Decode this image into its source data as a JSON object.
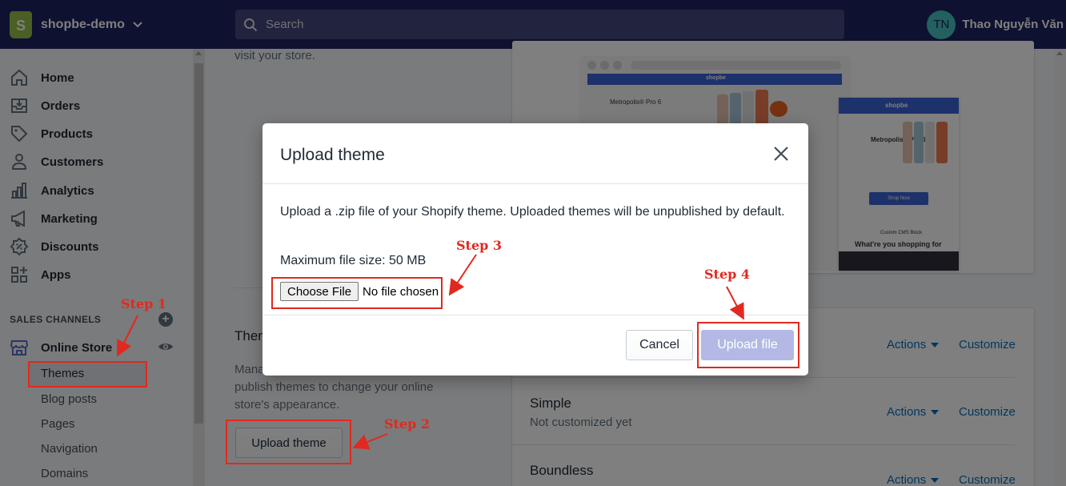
{
  "topbar": {
    "store_name": "shopbe-demo",
    "store_logo_letter": "S",
    "search_placeholder": "Search",
    "user_initials": "TN",
    "user_name": "Thao Nguyễn Văn"
  },
  "sidebar": {
    "items": [
      {
        "label": "Home",
        "icon": "home-icon"
      },
      {
        "label": "Orders",
        "icon": "orders-icon"
      },
      {
        "label": "Products",
        "icon": "tag-icon"
      },
      {
        "label": "Customers",
        "icon": "person-icon"
      },
      {
        "label": "Analytics",
        "icon": "bar-chart-icon"
      },
      {
        "label": "Marketing",
        "icon": "megaphone-icon"
      },
      {
        "label": "Discounts",
        "icon": "discount-icon"
      },
      {
        "label": "Apps",
        "icon": "apps-icon"
      }
    ],
    "sales_channels_title": "SALES CHANNELS",
    "online_store_label": "Online Store",
    "sub_items": [
      "Themes",
      "Blog posts",
      "Pages",
      "Navigation",
      "Domains"
    ]
  },
  "main": {
    "visit_text": "visit your store.",
    "themes_heading": "Them",
    "themes_desc_line1": "Mana",
    "themes_desc_line2": "publish themes to change your online",
    "themes_desc_line3": "store's appearance.",
    "upload_theme_label": "Upload theme",
    "rows": [
      {
        "name": "",
        "sub": "",
        "actions": "Actions",
        "customize": "Customize"
      },
      {
        "name": "Simple",
        "sub": "Not customized yet",
        "actions": "Actions",
        "customize": "Customize"
      },
      {
        "name": "Boundless",
        "sub": "",
        "actions": "Actions",
        "customize": "Customize"
      }
    ]
  },
  "preview": {
    "brand": "shopbe",
    "product_title": "Metropolis® Pro 6",
    "shop_now": "Shop Now",
    "cms_block": "Custom CMS Block",
    "shopping_for": "What're you shopping for"
  },
  "modal": {
    "title": "Upload theme",
    "description": "Upload a .zip file of your Shopify theme. Uploaded themes will be unpublished by default.",
    "max_size": "Maximum file size: 50 MB",
    "choose_file": "Choose File",
    "no_file": "No file chosen",
    "cancel": "Cancel",
    "upload": "Upload file"
  },
  "annotations": {
    "step1": "Step 1",
    "step2": "Step 2",
    "step3": "Step 3",
    "step4": "Step 4"
  },
  "colors": {
    "topbar": "#1c2260",
    "annotation": "#e1291f",
    "upload_disabled": "#b3b9e4",
    "link": "#006fbb"
  }
}
